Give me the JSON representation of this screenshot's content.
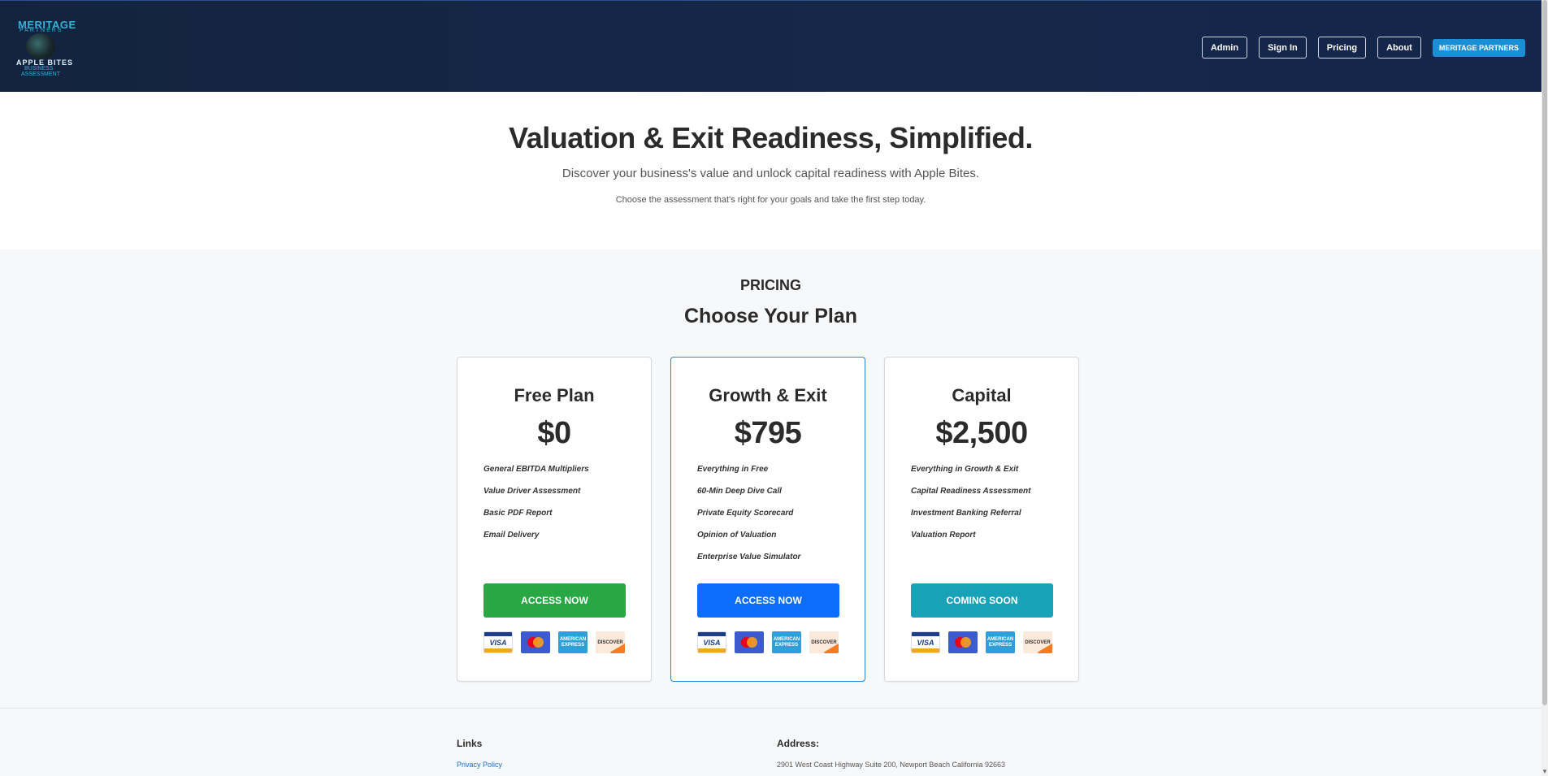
{
  "logo": {
    "line1": "MERITAGE",
    "line2": "PARTNERS",
    "line3": "APPLE BITES",
    "line4": "BUSINESS",
    "line5": "ASSESSMENT"
  },
  "nav": {
    "items": [
      "Admin",
      "Sign In",
      "Pricing",
      "About"
    ],
    "cta": "MERITAGE PARTNERS"
  },
  "hero": {
    "title": "Valuation & Exit Readiness, Simplified.",
    "subtitle": "Discover your business's value and unlock capital readiness with Apple Bites.",
    "tagline": "Choose the assessment that's right for your goals and take the first step today."
  },
  "pricing": {
    "eyebrow": "PRICING",
    "heading": "Choose Your Plan",
    "plans": [
      {
        "name": "Free Plan",
        "price": "$0",
        "features": [
          "General EBITDA Multipliers",
          "Value Driver Assessment",
          "Basic PDF Report",
          "Email Delivery"
        ],
        "cta": "ACCESS NOW",
        "cta_color": "#28a745"
      },
      {
        "name": "Growth & Exit",
        "price": "$795",
        "features": [
          "Everything in Free",
          "60-Min Deep Dive Call",
          "Private Equity Scorecard",
          "Opinion of Valuation",
          "Enterprise Value Simulator"
        ],
        "cta": "ACCESS NOW",
        "cta_color": "#0d6efd"
      },
      {
        "name": "Capital",
        "price": "$2,500",
        "features": [
          "Everything in Growth & Exit",
          "Capital Readiness Assessment",
          "Investment Banking Referral",
          "Valuation Report"
        ],
        "cta": "COMING SOON",
        "cta_color": "#17a2b8"
      }
    ],
    "payment_icons": {
      "visa": "VISA",
      "amex": "AMERICAN EXPRESS",
      "discover": "DISCOVER"
    }
  },
  "footer": {
    "links_heading": "Links",
    "privacy": "Privacy Policy",
    "address_heading": "Address:",
    "address": "2901 West Coast Highway Suite 200, Newport Beach California 92663"
  }
}
